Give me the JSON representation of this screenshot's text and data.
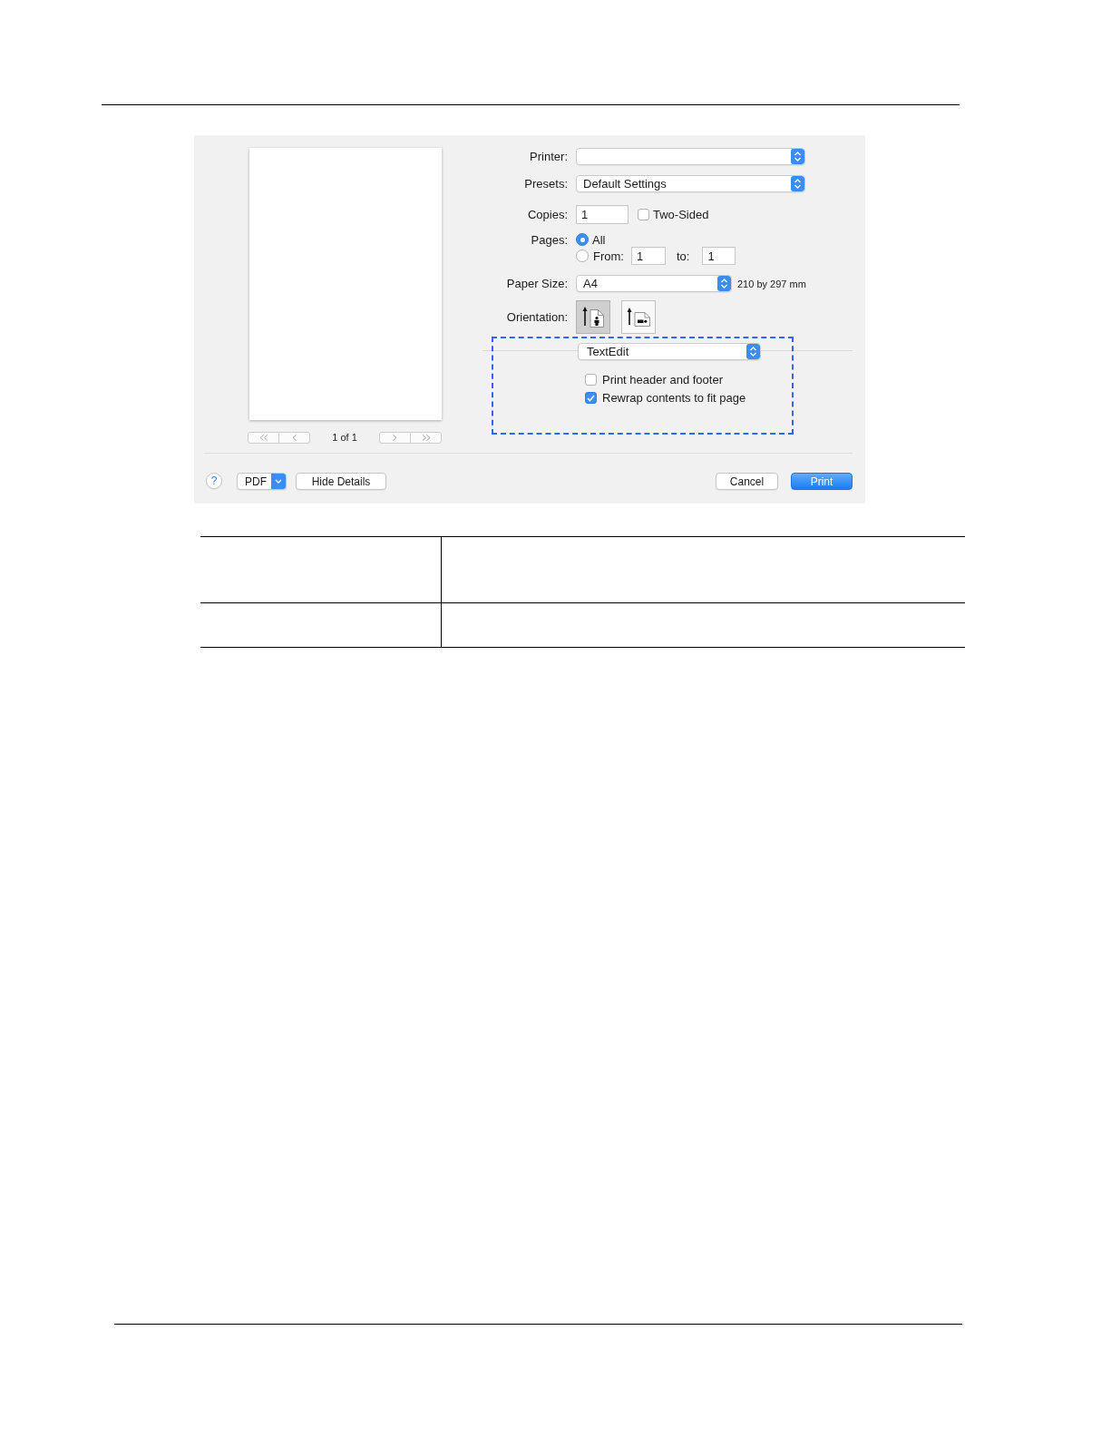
{
  "print_dialog": {
    "preview": {
      "page_indicator": "1 of 1"
    },
    "printer": {
      "label": "Printer:"
    },
    "presets": {
      "label": "Presets:",
      "value": "Default Settings"
    },
    "copies": {
      "label": "Copies:",
      "value": "1",
      "two_sided": {
        "label": "Two-Sided",
        "checked": false
      }
    },
    "pages": {
      "label": "Pages:",
      "options": [
        {
          "label": "All",
          "selected": true
        },
        {
          "label": "From:",
          "selected": false
        }
      ],
      "from": "1",
      "to_label": "to:",
      "to": "1"
    },
    "paper_size": {
      "label": "Paper Size:",
      "value": "A4",
      "dimensions": "210 by 297 mm"
    },
    "orientation": {
      "label": "Orientation:",
      "options": [
        {
          "kind": "portrait",
          "selected": true
        },
        {
          "kind": "landscape",
          "selected": false
        }
      ]
    },
    "app_options": {
      "highlighted": true,
      "menu": "TextEdit",
      "options": [
        {
          "label": "Print header and footer",
          "checked": false
        },
        {
          "label": "Rewrap contents to fit page",
          "checked": true
        }
      ]
    },
    "footer": {
      "help": "?",
      "pdf": "PDF",
      "details": "Hide Details",
      "cancel": {
        "label": "Cancel",
        "primary": false
      },
      "print": {
        "label": "Print",
        "primary": true
      }
    }
  }
}
